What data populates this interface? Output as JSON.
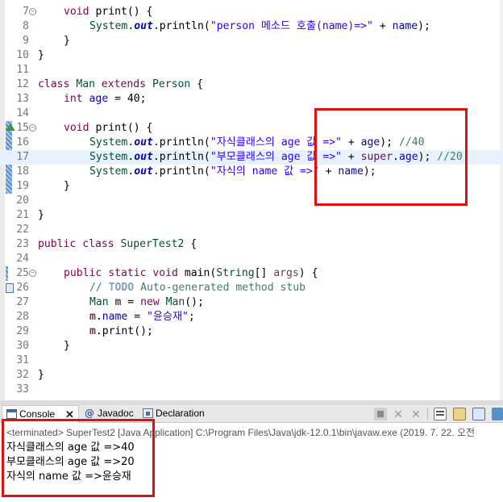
{
  "editor": {
    "lines": [
      {
        "no": "7",
        "fold": "−"
      },
      {
        "no": "8"
      },
      {
        "no": "9"
      },
      {
        "no": "10"
      },
      {
        "no": "11"
      },
      {
        "no": "12"
      },
      {
        "no": "13"
      },
      {
        "no": "14"
      },
      {
        "no": "15",
        "fold": "−"
      },
      {
        "no": "16"
      },
      {
        "no": "17"
      },
      {
        "no": "18"
      },
      {
        "no": "19"
      },
      {
        "no": "20"
      },
      {
        "no": "21"
      },
      {
        "no": "22"
      },
      {
        "no": "23"
      },
      {
        "no": "24"
      },
      {
        "no": "25",
        "fold": "−"
      },
      {
        "no": "26"
      },
      {
        "no": "27"
      },
      {
        "no": "28"
      },
      {
        "no": "29"
      },
      {
        "no": "30"
      },
      {
        "no": "31"
      },
      {
        "no": "32"
      },
      {
        "no": "33"
      }
    ],
    "tokens": {
      "l7": [
        "void",
        "print",
        "() {"
      ],
      "l8": [
        "System",
        ".",
        "out",
        ".println(",
        "\"person 메소드 호출(name)=>\"",
        " + ",
        "name",
        ");"
      ],
      "l9": [
        "}"
      ],
      "l10": [
        "}"
      ],
      "l12": [
        "class",
        "Man",
        "extends",
        "Person",
        " {"
      ],
      "l13": [
        "int",
        "age",
        " = ",
        "40",
        ";"
      ],
      "l15": [
        "void",
        "print",
        "() {"
      ],
      "l16": [
        "System",
        ".",
        "out",
        ".println(",
        "\"자식클래스의 age 값 =>\"",
        " + ",
        "age",
        "); ",
        "//40"
      ],
      "l17": [
        "System",
        ".",
        "out",
        ".println(",
        "\"부모클래스의 age 값 =>\"",
        " + ",
        "super",
        ".",
        "age",
        "); ",
        "//20"
      ],
      "l18": [
        "System",
        ".",
        "out",
        ".println(",
        "\"자식의 name 값 =>\"",
        " + ",
        "name",
        ");"
      ],
      "l19": [
        "}"
      ],
      "l21": [
        "}"
      ],
      "l23": [
        "public",
        "class",
        "SuperTest2",
        " {"
      ],
      "l25": [
        "public",
        "static",
        "void",
        "main",
        "(",
        "String",
        "[] ",
        "args",
        ") {"
      ],
      "l26": [
        "// ",
        "TODO",
        " Auto-generated method stub"
      ],
      "l27": [
        "Man",
        " ",
        "m",
        " = ",
        "new",
        " ",
        "Man",
        "();"
      ],
      "l28": [
        "m",
        ".",
        "name",
        " = ",
        "\"윤승재\"",
        ";"
      ],
      "l29": [
        "m",
        ".print();"
      ],
      "l30": [
        "}"
      ],
      "l32": [
        "}"
      ]
    }
  },
  "console": {
    "tabs": [
      {
        "label": "Console",
        "icon": "console-icon",
        "close": "✕"
      },
      {
        "label": "Javadoc",
        "icon": "javadoc-icon"
      },
      {
        "label": "Declaration",
        "icon": "declaration-icon"
      }
    ],
    "status": "<terminated> SuperTest2 [Java Application] C:\\Program Files\\Java\\jdk-12.0.1\\bin\\javaw.exe (2019. 7. 22. 오전",
    "output": [
      "자식클래스의 age 값 =>40",
      "부모클래스의 age 값 =>20",
      "자식의 name 값 =>윤승재"
    ]
  },
  "colors": {
    "keyword": "#7f0055",
    "string": "#2a00ff",
    "field": "#0000c0",
    "comment": "#3f7f5f",
    "highlight_box": "#e01010",
    "current_line": "#e8f2fe"
  }
}
